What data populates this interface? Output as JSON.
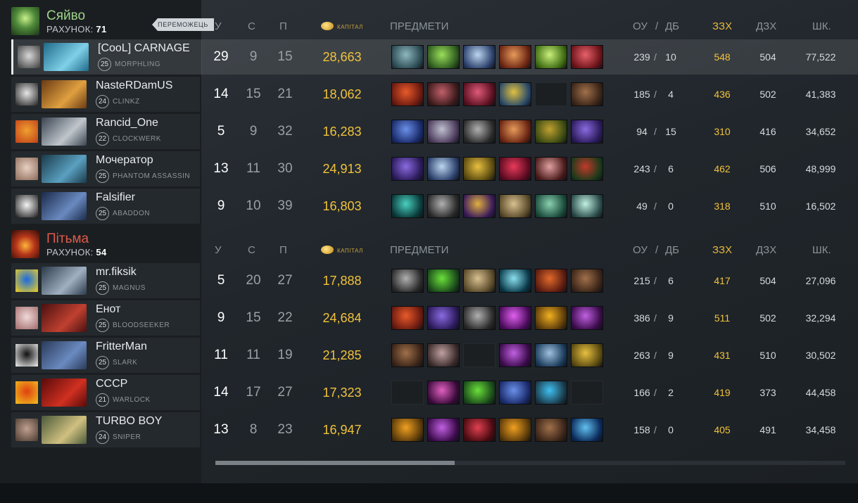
{
  "radiant": {
    "name": "Сяйво",
    "score_label": "РАХУНОК:",
    "score": "71",
    "winner_label": "ПЕРЕМОЖЕЦЬ"
  },
  "dire": {
    "name": "Пітьма",
    "score_label": "РАХУНОК:",
    "score": "54"
  },
  "columns": {
    "kills": "У",
    "deaths": "С",
    "assists": "П",
    "gold": "КАПІТАЛ",
    "items": "ПРЕДМЕТИ",
    "lh": "ОУ",
    "slash": "/",
    "dn": "ДБ",
    "gpm": "ЗЗХ",
    "xpm": "ДЗХ",
    "damage": "ШК."
  },
  "radiant_players": [
    {
      "name": "[CooL] CARNAGE",
      "level": "25",
      "hero": "MORPHLING",
      "k": "29",
      "d": "9",
      "a": "15",
      "nw": "28,663",
      "lh": "239",
      "dn": "10",
      "gpm": "548",
      "xpm": "504",
      "dmg": "77,522",
      "avatar": [
        "#d8d8d8",
        "#3a3a3a"
      ],
      "hero_colors": [
        "#1f6a8a",
        "#7fd0e8"
      ],
      "items": [
        [
          "#2b4a52",
          "#8fb7bf"
        ],
        [
          "#2e5a20",
          "#9adf5a"
        ],
        [
          "#2a3f6a",
          "#bcd6f0"
        ],
        [
          "#6a2412",
          "#e79a5a"
        ],
        [
          "#3d6a12",
          "#c8f07a"
        ],
        [
          "#6a1218",
          "#e8606a"
        ]
      ]
    },
    {
      "name": "NasteRDamUS",
      "level": "24",
      "hero": "CLINKZ",
      "k": "14",
      "d": "15",
      "a": "21",
      "nw": "18,062",
      "lh": "185",
      "dn": "4",
      "gpm": "436",
      "xpm": "502",
      "dmg": "41,383",
      "avatar": [
        "#e6e6e6",
        "#222222"
      ],
      "hero_colors": [
        "#6a3a12",
        "#e0a040"
      ],
      "items": [
        [
          "#6a1a10",
          "#e85a2a"
        ],
        [
          "#3a1a1a",
          "#c0606a"
        ],
        [
          "#5a1020",
          "#e05a7a"
        ],
        [
          "#2a4a6a",
          "#e0c040"
        ],
        null,
        [
          "#3a2418",
          "#a0704a"
        ]
      ]
    },
    {
      "name": "Rancid_One",
      "level": "22",
      "hero": "CLOCKWERK",
      "k": "5",
      "d": "9",
      "a": "32",
      "nw": "16,283",
      "lh": "94",
      "dn": "15",
      "gpm": "310",
      "xpm": "416",
      "dmg": "34,652",
      "avatar": [
        "#f0a030",
        "#c04018"
      ],
      "hero_colors": [
        "#3a4450",
        "#c0c6cc"
      ],
      "items": [
        [
          "#1a2a6a",
          "#6a90e8"
        ],
        [
          "#4a3a5a",
          "#c0c0d0"
        ],
        [
          "#2a2a2a",
          "#b0b0b0"
        ],
        [
          "#6a2412",
          "#e79a5a"
        ],
        [
          "#3a4a12",
          "#c0a030"
        ],
        [
          "#2a1a5a",
          "#8a6ae0"
        ]
      ]
    },
    {
      "name": "Мочератор",
      "level": "25",
      "hero": "PHANTOM ASSASSIN",
      "k": "13",
      "d": "11",
      "a": "30",
      "nw": "24,913",
      "lh": "243",
      "dn": "6",
      "gpm": "462",
      "xpm": "506",
      "dmg": "48,999",
      "avatar": [
        "#e8d0c0",
        "#8a6a5a"
      ],
      "hero_colors": [
        "#1a3a4a",
        "#5aa0c0"
      ],
      "items": [
        [
          "#2a1a5a",
          "#8a6ae0"
        ],
        [
          "#2a3f6a",
          "#bcd6f0"
        ],
        [
          "#5a4a10",
          "#e8c040"
        ],
        [
          "#5a0a20",
          "#e83a5a"
        ],
        [
          "#4a1a1a",
          "#e0a0a0"
        ],
        [
          "#1a3a1a",
          "#c03a2a"
        ]
      ]
    },
    {
      "name": "Falsifier",
      "level": "25",
      "hero": "ABADDON",
      "k": "9",
      "d": "10",
      "a": "39",
      "nw": "16,803",
      "lh": "49",
      "dn": "0",
      "gpm": "318",
      "xpm": "510",
      "dmg": "16,502",
      "avatar": [
        "#f4f4f4",
        "#1a1a1a"
      ],
      "hero_colors": [
        "#1a2a4a",
        "#6a8ac0"
      ],
      "items": [
        [
          "#0a3a3a",
          "#4ad0c0"
        ],
        [
          "#2a2a2a",
          "#b0b0b0"
        ],
        [
          "#3a1a5a",
          "#e0b040"
        ],
        [
          "#5a4a2a",
          "#d8c090"
        ],
        [
          "#1a4a3a",
          "#8ad0b0"
        ],
        [
          "#2a4a4a",
          "#c0f0e0"
        ]
      ]
    }
  ],
  "dire_players": [
    {
      "name": "mr.fiksik",
      "level": "25",
      "hero": "MAGNUS",
      "k": "5",
      "d": "20",
      "a": "27",
      "nw": "17,888",
      "lh": "215",
      "dn": "6",
      "gpm": "417",
      "xpm": "504",
      "dmg": "27,096",
      "avatar": [
        "#1a6ae0",
        "#f0d020"
      ],
      "hero_colors": [
        "#2a3a4a",
        "#a0b0c0"
      ],
      "items": [
        [
          "#2a2a2a",
          "#b0b0b0"
        ],
        [
          "#1a4a1a",
          "#6ae03a"
        ],
        [
          "#5a4a2a",
          "#d8c090"
        ],
        [
          "#0a3a4a",
          "#8ae0f0"
        ],
        [
          "#5a1a10",
          "#e06a2a"
        ],
        [
          "#3a2418",
          "#a0704a"
        ]
      ]
    },
    {
      "name": "Енот",
      "level": "25",
      "hero": "BLOODSEEKER",
      "k": "9",
      "d": "15",
      "a": "22",
      "nw": "24,684",
      "lh": "386",
      "dn": "9",
      "gpm": "511",
      "xpm": "502",
      "dmg": "32,294",
      "avatar": [
        "#f0d8d8",
        "#a06a6a"
      ],
      "hero_colors": [
        "#4a1010",
        "#c04030"
      ],
      "items": [
        [
          "#6a1a10",
          "#e85a2a"
        ],
        [
          "#2a1a5a",
          "#8a6ae0"
        ],
        [
          "#2a2a2a",
          "#b0b0b0"
        ],
        [
          "#4a0a5a",
          "#e060f0"
        ],
        [
          "#5a3a0a",
          "#f0b020"
        ],
        [
          "#3a0a4a",
          "#c060e0"
        ]
      ]
    },
    {
      "name": "FritterMan",
      "level": "25",
      "hero": "SLARK",
      "k": "11",
      "d": "11",
      "a": "19",
      "nw": "21,285",
      "lh": "263",
      "dn": "9",
      "gpm": "431",
      "xpm": "510",
      "dmg": "30,502",
      "avatar": [
        "#101010",
        "#f0f0f0"
      ],
      "hero_colors": [
        "#2a3a5a",
        "#6a8ac0"
      ],
      "items": [
        [
          "#3a2418",
          "#a0704a"
        ],
        [
          "#3a2a2a",
          "#c0a0a0"
        ],
        null,
        [
          "#3a0a4a",
          "#c060e0"
        ],
        [
          "#1a3a5a",
          "#a0c0e0"
        ],
        [
          "#5a4a10",
          "#e8c040"
        ]
      ]
    },
    {
      "name": "CCCP",
      "level": "21",
      "hero": "WARLOCK",
      "k": "14",
      "d": "17",
      "a": "27",
      "nw": "17,323",
      "lh": "166",
      "dn": "2",
      "gpm": "419",
      "xpm": "373",
      "dmg": "44,458",
      "avatar": [
        "#e04010",
        "#f0c020"
      ],
      "hero_colors": [
        "#5a0a0a",
        "#d03020"
      ],
      "items": [
        null,
        [
          "#3a0a3a",
          "#e060c0"
        ],
        [
          "#1a4a1a",
          "#6ae03a"
        ],
        [
          "#1a2a6a",
          "#6a90e8"
        ],
        [
          "#1a3a4a",
          "#40c0f0"
        ],
        null
      ]
    },
    {
      "name": "TURBO BOY",
      "level": "24",
      "hero": "SNIPER",
      "k": "13",
      "d": "8",
      "a": "23",
      "nw": "16,947",
      "lh": "158",
      "dn": "0",
      "gpm": "405",
      "xpm": "491",
      "dmg": "34,458",
      "avatar": [
        "#c0a090",
        "#4a3a30"
      ],
      "hero_colors": [
        "#4a5a3a",
        "#d0c080"
      ],
      "items": [
        [
          "#5a3a0a",
          "#f0a020"
        ],
        [
          "#3a0a4a",
          "#c060e0"
        ],
        [
          "#4a0a10",
          "#e04050"
        ],
        [
          "#5a3a0a",
          "#f0a020"
        ],
        [
          "#3a2418",
          "#a0704a"
        ],
        [
          "#0a2a5a",
          "#60c0f0"
        ]
      ]
    }
  ]
}
